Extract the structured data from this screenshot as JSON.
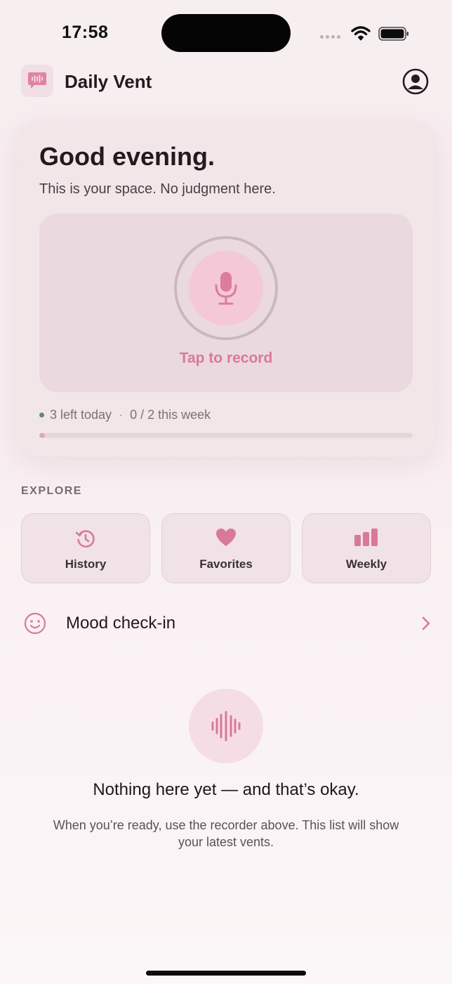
{
  "status_bar": {
    "time": "17:58",
    "icons": [
      "cellular-dots-icon",
      "wifi-icon",
      "battery-icon"
    ]
  },
  "header": {
    "app_title": "Daily Vent",
    "logo_icon": "waveform-bubble-icon",
    "profile_icon": "profile-icon"
  },
  "hero": {
    "greeting": "Good evening.",
    "subline": "This is your space. No judgment here.",
    "record_label": "Tap to record",
    "mic_icon": "microphone-icon",
    "quota_today": "3 left today",
    "quota_separator": "·",
    "quota_week": "0 / 2 this week",
    "progress_fraction": 0.015
  },
  "explore": {
    "section_label": "EXPLORE",
    "tiles": [
      {
        "label": "History",
        "icon": "history-clock-icon"
      },
      {
        "label": "Favorites",
        "icon": "heart-icon"
      },
      {
        "label": "Weekly",
        "icon": "bar-chart-icon"
      }
    ]
  },
  "mood": {
    "label": "Mood check-in",
    "icon": "smiley-icon",
    "chevron": "chevron-right-icon"
  },
  "empty_state": {
    "icon": "waveform-icon",
    "title": "Nothing here yet — and that’s okay.",
    "description": "When you’re ready, use the recorder above. This list will show your latest vents."
  },
  "colors": {
    "accent": "#d9799a",
    "accent_soft": "#f5c8d7",
    "card": "#f2e6e9",
    "status_dot": "#5f8b73"
  }
}
